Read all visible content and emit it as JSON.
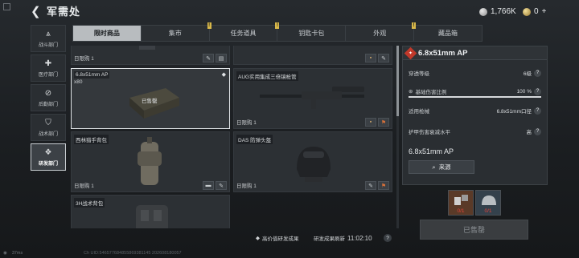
{
  "header": {
    "back_glyph": "❮",
    "title": "军需处",
    "currency_silver": "1,766K",
    "currency_gold": "0",
    "gold_add": "+"
  },
  "leftnav": [
    {
      "label": "战斗部门",
      "icon": "rank-chevron-icon",
      "glyph": "⩓"
    },
    {
      "label": "医疗部门",
      "icon": "medical-cross-icon",
      "glyph": "✚"
    },
    {
      "label": "后勤部门",
      "icon": "logistics-gear-icon",
      "glyph": "⊘"
    },
    {
      "label": "战术部门",
      "icon": "shield-icon",
      "glyph": "⛉"
    },
    {
      "label": "研发部门",
      "icon": "research-diamond-icon",
      "glyph": "❖"
    }
  ],
  "tabs": [
    {
      "label": "限时商品",
      "active": true,
      "marked": false
    },
    {
      "label": "集市",
      "active": false,
      "marked": true
    },
    {
      "label": "任务道具",
      "active": false,
      "marked": true
    },
    {
      "label": "钥匙卡包",
      "active": false,
      "marked": false
    },
    {
      "label": "外观",
      "active": false,
      "marked": true
    },
    {
      "label": "藏品箱",
      "active": false,
      "marked": false
    }
  ],
  "grid": {
    "top_row": [
      {
        "limit": "日限购 1"
      },
      {
        "limit": ""
      }
    ],
    "ammo": {
      "name": "6.8x51mm AP",
      "qty": "x80",
      "status": "已售罄"
    },
    "scope": {
      "name": "AUG实用集成三倍镜枪管",
      "limit": "日限购 1"
    },
    "backpack": {
      "name": "西林猎手背包",
      "limit": "日限购 1"
    },
    "helmet": {
      "name": "DAS 防弹头盔",
      "limit": "日限购 1"
    },
    "chest": {
      "name": "3H战术背包"
    }
  },
  "footer": {
    "high_value": "高价值研发成果",
    "refresh_label": "研发成果刷新",
    "refresh_time": "11:02:10",
    "fps": "37ms",
    "uid": "Ch UID:546577684855869381145 202608180057"
  },
  "detail": {
    "title": "6.8x51mm AP",
    "pen_label": "穿透等级",
    "pen_value": "6级",
    "dmg_label": "基础伤害比例",
    "dmg_value": "100 %",
    "dmg_fraction": 1.0,
    "gun_label": "适用枪械",
    "gun_value": "6.8x51mm口径",
    "armor_label": "护甲伤害衰减水平",
    "armor_value": "高",
    "name": "6.8x51mm AP",
    "source_label": "来源",
    "materials": [
      {
        "icon": "component-parts-icon",
        "count": "0/1"
      },
      {
        "icon": "helmet-material-icon",
        "count": "0/1"
      }
    ],
    "sold_label": "已售罄"
  },
  "colors": {
    "accent_red": "#c0392b",
    "tab_active": "#b8bcbf",
    "badge_yellow": "#d8b84a"
  }
}
